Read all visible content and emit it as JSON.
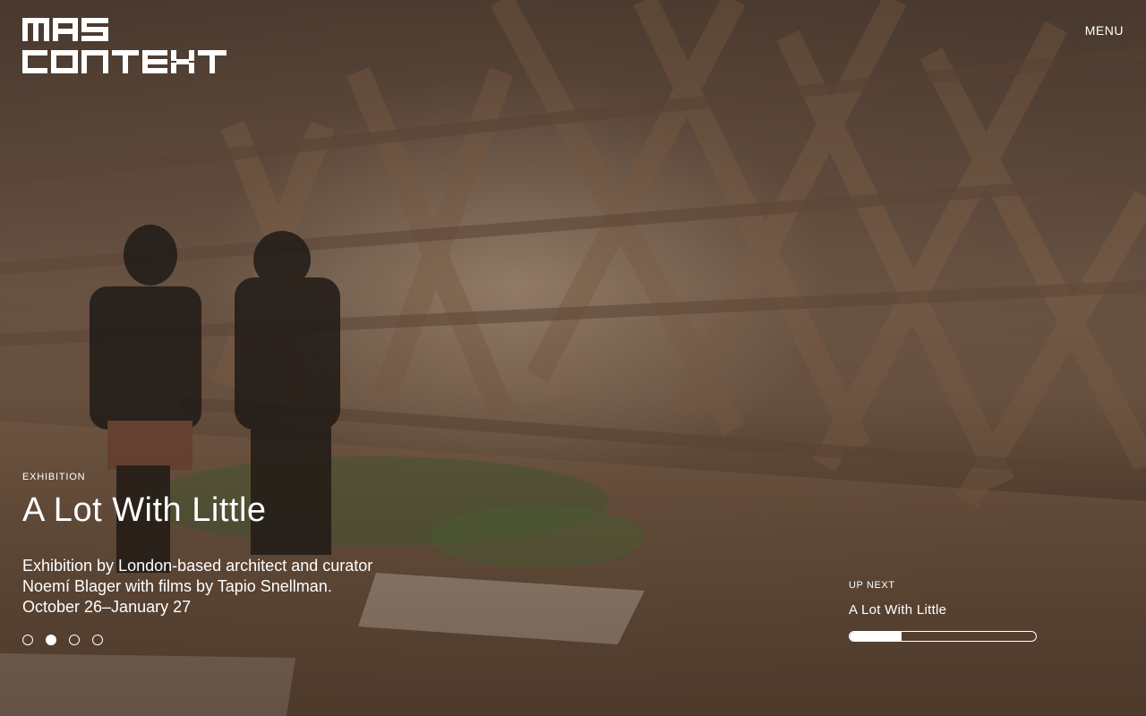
{
  "brand": {
    "logo_text": "MAS CONTEXT"
  },
  "header": {
    "menu_label": "MENU"
  },
  "slide": {
    "category": "EXHIBITION",
    "title": "A Lot With Little",
    "description_lines": [
      "Exhibition by London-based architect and curator",
      "Noemí Blager with films by Tapio Snellman.",
      "October 26–January 27"
    ]
  },
  "pager": {
    "count": 4,
    "active_index": 1
  },
  "up_next": {
    "label": "UP NEXT",
    "title": "A Lot With Little",
    "progress": 0.28
  },
  "colors": {
    "text": "#ffffff",
    "overlay": "#3a2a20"
  }
}
